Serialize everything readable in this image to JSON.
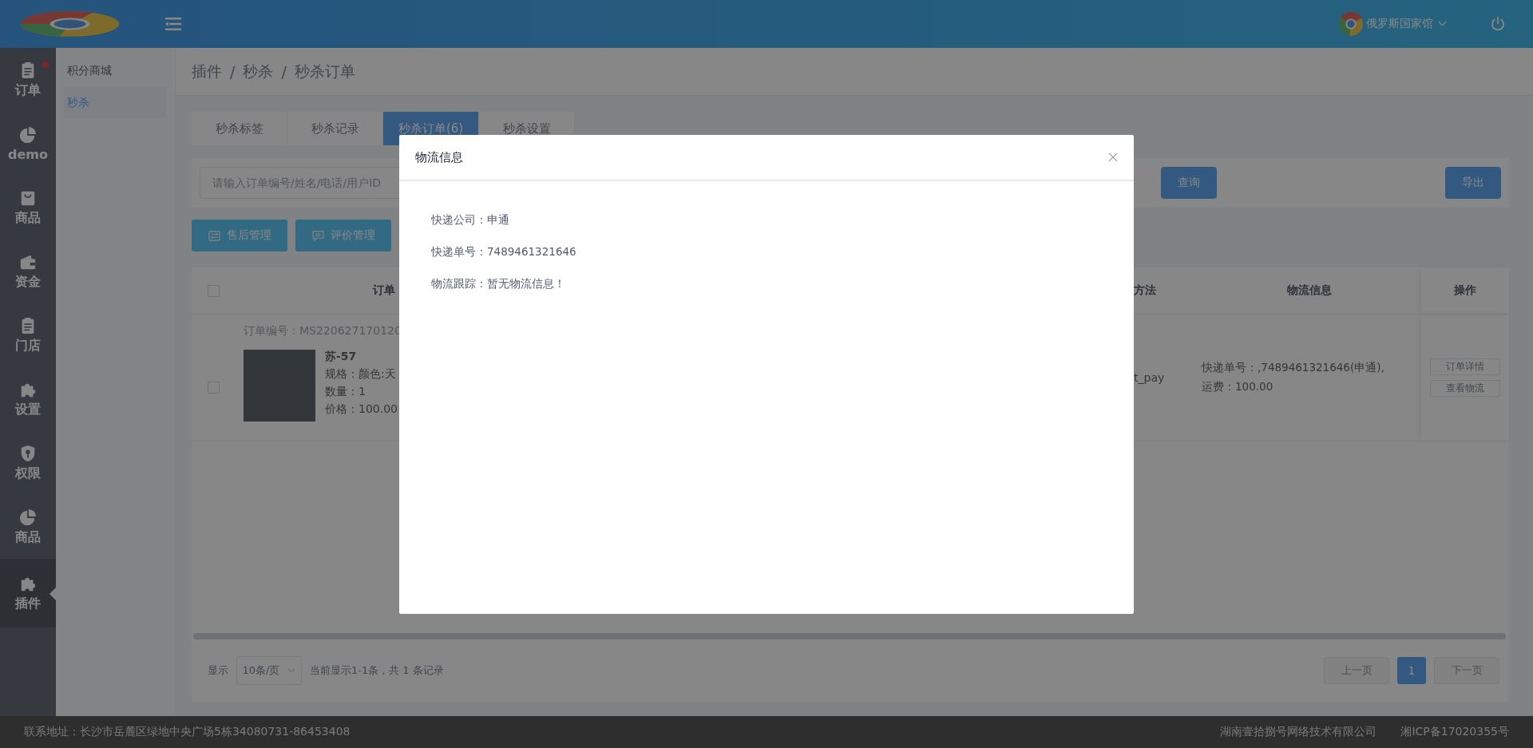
{
  "header": {
    "user_name": "俄罗斯国家馆"
  },
  "nav_rail": [
    {
      "label": "订单",
      "kind": "clipboard",
      "notification_dot": true,
      "selected": false
    },
    {
      "label": "demo",
      "kind": "pie",
      "notification_dot": false,
      "selected": false
    },
    {
      "label": "商品",
      "kind": "bag",
      "notification_dot": false,
      "selected": false
    },
    {
      "label": "资金",
      "kind": "wallet",
      "notification_dot": false,
      "selected": false
    },
    {
      "label": "门店",
      "kind": "clipboard",
      "notification_dot": false,
      "selected": false
    },
    {
      "label": "设置",
      "kind": "puzzle",
      "notification_dot": false,
      "selected": false
    },
    {
      "label": "权限",
      "kind": "shield",
      "notification_dot": false,
      "selected": false
    },
    {
      "label": "商品",
      "kind": "pie",
      "notification_dot": false,
      "selected": false
    },
    {
      "label": "插件",
      "kind": "puzzle",
      "notification_dot": false,
      "selected": true
    }
  ],
  "submenu": [
    {
      "label": "积分商城",
      "selected": false
    },
    {
      "label": "秒杀",
      "selected": true
    }
  ],
  "breadcrumb": {
    "items": [
      "插件",
      "秒杀",
      "秒杀订单"
    ],
    "separator": "/"
  },
  "tabs": [
    {
      "label": "秒杀标签",
      "selected": false
    },
    {
      "label": "秒杀记录",
      "selected": false
    },
    {
      "label": "秒杀订单(6)",
      "selected": true
    },
    {
      "label": "秒杀设置",
      "selected": false
    }
  ],
  "search": {
    "placeholder": "请输入订单编号/姓名/电话/用户ID",
    "query_button": "查询",
    "export_button": "导出"
  },
  "actions": [
    {
      "label": "售后管理",
      "kind": "exchange"
    },
    {
      "label": "评价管理",
      "kind": "comment"
    }
  ],
  "table": {
    "select_all_checked": false,
    "columns": [
      "订单",
      "方法",
      "物流信息",
      "操作"
    ],
    "rows": [
      {
        "checked": false,
        "order_no": "订单编号：MS220627170120",
        "product_name": "苏-57",
        "spec": "规格：颜色:天",
        "quantity": "数量：1",
        "price": "价格：100.00",
        "payment": "t_pay",
        "logistics": [
          "快递单号：,7489461321646(申通),",
          "运费：100.00"
        ],
        "operations": [
          "订单详情",
          "查看物流"
        ]
      }
    ]
  },
  "pagination": {
    "show_label": "显示",
    "page_size": "10条/页",
    "summary": "当前显示1-1条，共 1 条记录",
    "prev": "上一页",
    "prev_disabled": true,
    "next": "下一页",
    "next_disabled": true,
    "pages": [
      {
        "label": "1",
        "selected": true
      }
    ]
  },
  "footer": {
    "address": "联系地址：长沙市岳麓区绿地中央广场5栋34080731-86453408",
    "company": "湖南壹拾捌号网络技术有限公司",
    "icp": "湘ICP备17020355号"
  },
  "dialog": {
    "title": "物流信息",
    "lines": [
      "快递公司：申通",
      "快递单号：7489461321646",
      "物流跟踪：暂无物流信息！"
    ]
  }
}
